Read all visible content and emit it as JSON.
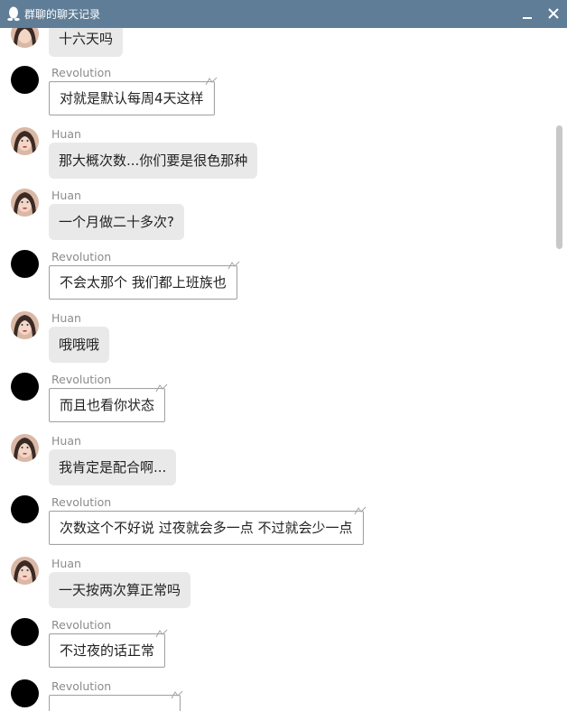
{
  "window": {
    "title": "群聊的聊天记录",
    "app_icon": "qq-penguin-icon",
    "minimize_icon": "minimize-icon",
    "close_icon": "close-icon"
  },
  "messages": [
    {
      "sender": "",
      "text": "十六天吗",
      "avatar": "photo",
      "style": "gray"
    },
    {
      "sender": "Revolution",
      "text": "对就是默认每周4天这样",
      "avatar": "black",
      "style": "outlined"
    },
    {
      "sender": "Huan",
      "text": "那大概次数...你们要是很色那种",
      "avatar": "photo",
      "style": "gray"
    },
    {
      "sender": "Huan",
      "text": "一个月做二十多次?",
      "avatar": "photo",
      "style": "gray"
    },
    {
      "sender": "Revolution",
      "text": "不会太那个 我们都上班族也",
      "avatar": "black",
      "style": "outlined"
    },
    {
      "sender": "Huan",
      "text": "哦哦哦",
      "avatar": "photo",
      "style": "gray"
    },
    {
      "sender": "Revolution",
      "text": "而且也看你状态",
      "avatar": "black",
      "style": "outlined"
    },
    {
      "sender": "Huan",
      "text": "我肯定是配合啊...",
      "avatar": "photo",
      "style": "gray"
    },
    {
      "sender": "Revolution",
      "text": "次数这个不好说 过夜就会多一点 不过就会少一点",
      "avatar": "black",
      "style": "outlined"
    },
    {
      "sender": "Huan",
      "text": "一天按两次算正常吗",
      "avatar": "photo",
      "style": "gray"
    },
    {
      "sender": "Revolution",
      "text": "不过夜的话正常",
      "avatar": "black",
      "style": "outlined"
    },
    {
      "sender": "Revolution",
      "text": "",
      "avatar": "black",
      "style": "outlined"
    }
  ]
}
